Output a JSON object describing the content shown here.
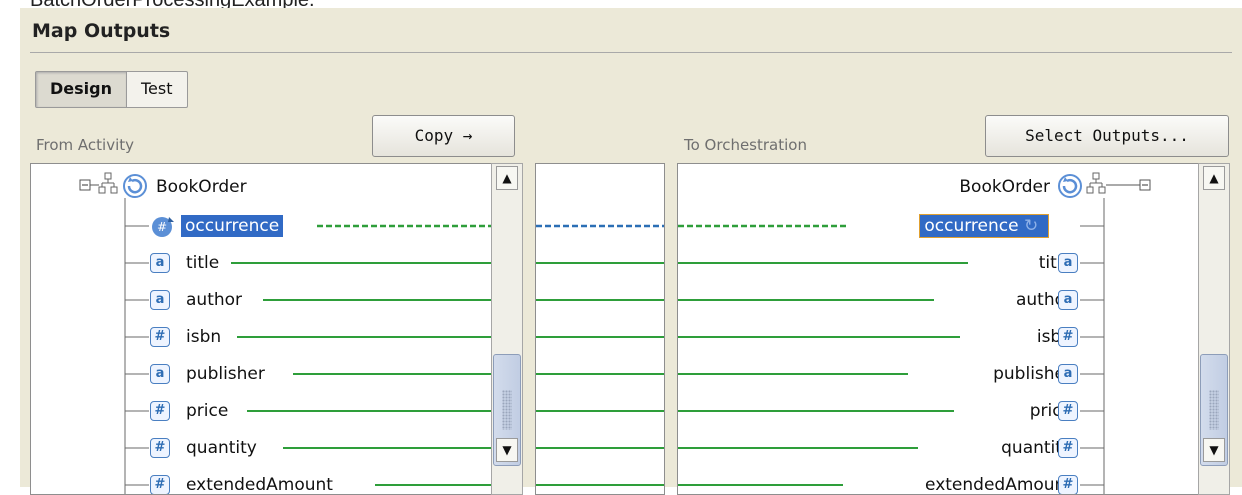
{
  "caption": "BatchOrderProcessingExample.",
  "panel": {
    "title": "Map Outputs",
    "tabs": [
      {
        "label": "Design",
        "active": true
      },
      {
        "label": "Test",
        "active": false
      }
    ]
  },
  "left_pane": {
    "label": "From Activity",
    "copy_button": "Copy →"
  },
  "right_pane": {
    "label": "To Orchestration",
    "select_button": "Select Outputs..."
  },
  "tree": {
    "root": "BookOrder",
    "fields": [
      {
        "name": "occurrence",
        "type_icon": "repeat-number-icon",
        "badge": "#",
        "selected": true
      },
      {
        "name": "title",
        "type_icon": "string-type-icon",
        "badge": "a"
      },
      {
        "name": "author",
        "type_icon": "string-type-icon",
        "badge": "a"
      },
      {
        "name": "isbn",
        "type_icon": "number-type-icon",
        "badge": "#"
      },
      {
        "name": "publisher",
        "type_icon": "string-type-icon",
        "badge": "a"
      },
      {
        "name": "price",
        "type_icon": "number-type-icon",
        "badge": "#"
      },
      {
        "name": "quantity",
        "type_icon": "number-type-icon",
        "badge": "#"
      },
      {
        "name": "extendedAmount",
        "type_icon": "number-type-icon",
        "badge": "#"
      }
    ]
  },
  "colors": {
    "panel_bg": "#ece9d8",
    "selection": "#316ac5",
    "map_line": "#2e9e3a",
    "dashed_green": "#2e9e3a",
    "dashed_blue": "#2b6fb5"
  }
}
